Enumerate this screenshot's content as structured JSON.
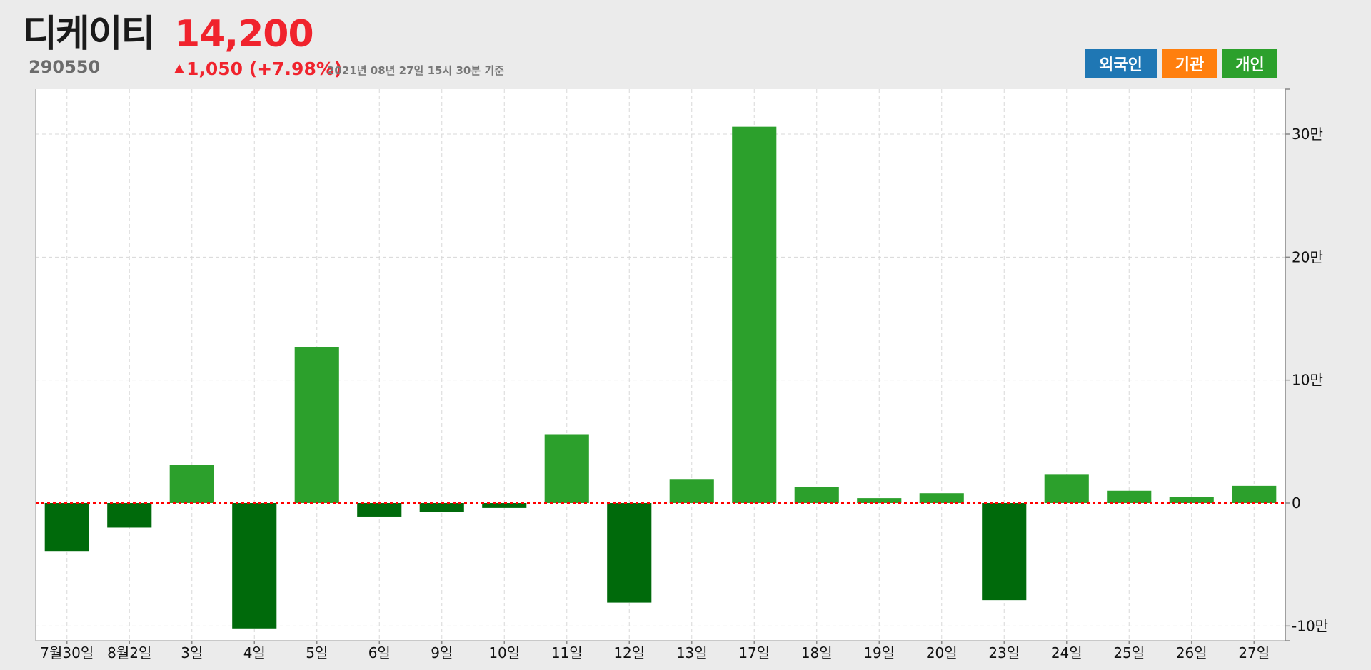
{
  "header": {
    "name": "디케이티",
    "code": "290550",
    "price": "14,200",
    "change": "1,050 (+7.98%)",
    "as_of": "2021년 08년 27일 15시 30분 기준"
  },
  "buttons": {
    "foreign": "외국인",
    "institution": "기관",
    "individual": "개인"
  },
  "colors": {
    "positive": "#2ca02c",
    "negative": "#006a0b",
    "zero_line": "#ff0000",
    "price_up": "#f0232d"
  },
  "chart_data": {
    "type": "bar",
    "categories": [
      "7월30일",
      "8월2일",
      "3일",
      "4일",
      "5일",
      "6일",
      "9일",
      "10일",
      "11일",
      "12일",
      "13일",
      "17일",
      "18일",
      "19일",
      "20일",
      "23일",
      "24일",
      "25일",
      "26일",
      "27일"
    ],
    "values": [
      -39000,
      -20000,
      31000,
      -102000,
      127000,
      -11000,
      -7000,
      -4000,
      56000,
      -81000,
      19000,
      306000,
      13000,
      4000,
      8000,
      -79000,
      23000,
      10000,
      5000,
      14000
    ],
    "ylim": [
      -110000,
      335000
    ],
    "yticks": [
      -100000,
      0,
      100000,
      200000,
      300000
    ],
    "ytick_labels": [
      "-10만",
      "0",
      "10만",
      "20만",
      "30만"
    ],
    "grid": true,
    "zero_line": true
  }
}
